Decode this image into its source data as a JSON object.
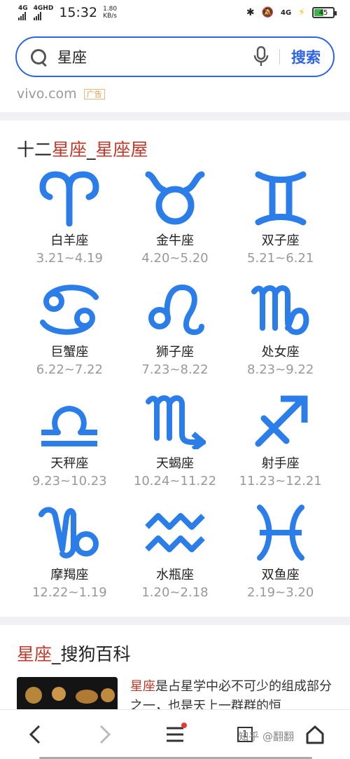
{
  "status_bar": {
    "net1": "4G",
    "net2": "4GHD",
    "time": "15:32",
    "speed_value": "1.80",
    "speed_unit": "KB/s",
    "net3": "4G",
    "battery": "45",
    "battery_level": 0.45,
    "battery_color": "#3bb54a"
  },
  "search": {
    "query": "星座",
    "button_label": "搜索",
    "accent_color": "#2d64e6"
  },
  "ad": {
    "source": "vivo.com",
    "tag": "广告"
  },
  "card1": {
    "title_prefix": "十二",
    "title_hl1": "星座",
    "title_sep": "_",
    "title_hl2": "星座屋",
    "highlight_color": "#c0392b",
    "zodiac": [
      {
        "name": "白羊座",
        "date": "3.21~4.19",
        "icon": "aries-icon"
      },
      {
        "name": "金牛座",
        "date": "4.20~5.20",
        "icon": "taurus-icon"
      },
      {
        "name": "双子座",
        "date": "5.21~6.21",
        "icon": "gemini-icon"
      },
      {
        "name": "巨蟹座",
        "date": "6.22~7.22",
        "icon": "cancer-icon"
      },
      {
        "name": "狮子座",
        "date": "7.23~8.22",
        "icon": "leo-icon"
      },
      {
        "name": "处女座",
        "date": "8.23~9.22",
        "icon": "virgo-icon"
      },
      {
        "name": "天秤座",
        "date": "9.23~10.23",
        "icon": "libra-icon"
      },
      {
        "name": "天蝎座",
        "date": "10.24~11.22",
        "icon": "scorpio-icon"
      },
      {
        "name": "射手座",
        "date": "11.23~12.21",
        "icon": "sagittarius-icon"
      },
      {
        "name": "摩羯座",
        "date": "12.22~1.19",
        "icon": "capricorn-icon"
      },
      {
        "name": "水瓶座",
        "date": "1.20~2.18",
        "icon": "aquarius-icon"
      },
      {
        "name": "双鱼座",
        "date": "2.19~3.20",
        "icon": "pisces-icon"
      }
    ]
  },
  "card2": {
    "title_hl": "星座",
    "title_rest": "_搜狗百科",
    "snippet_hl": "星座",
    "snippet_rest": "是占星学中必不可少的组成部分之一，也是天上一群群的恒"
  },
  "bottom_nav": {
    "tab_count": "1",
    "watermark": "知乎 @翻翻"
  }
}
